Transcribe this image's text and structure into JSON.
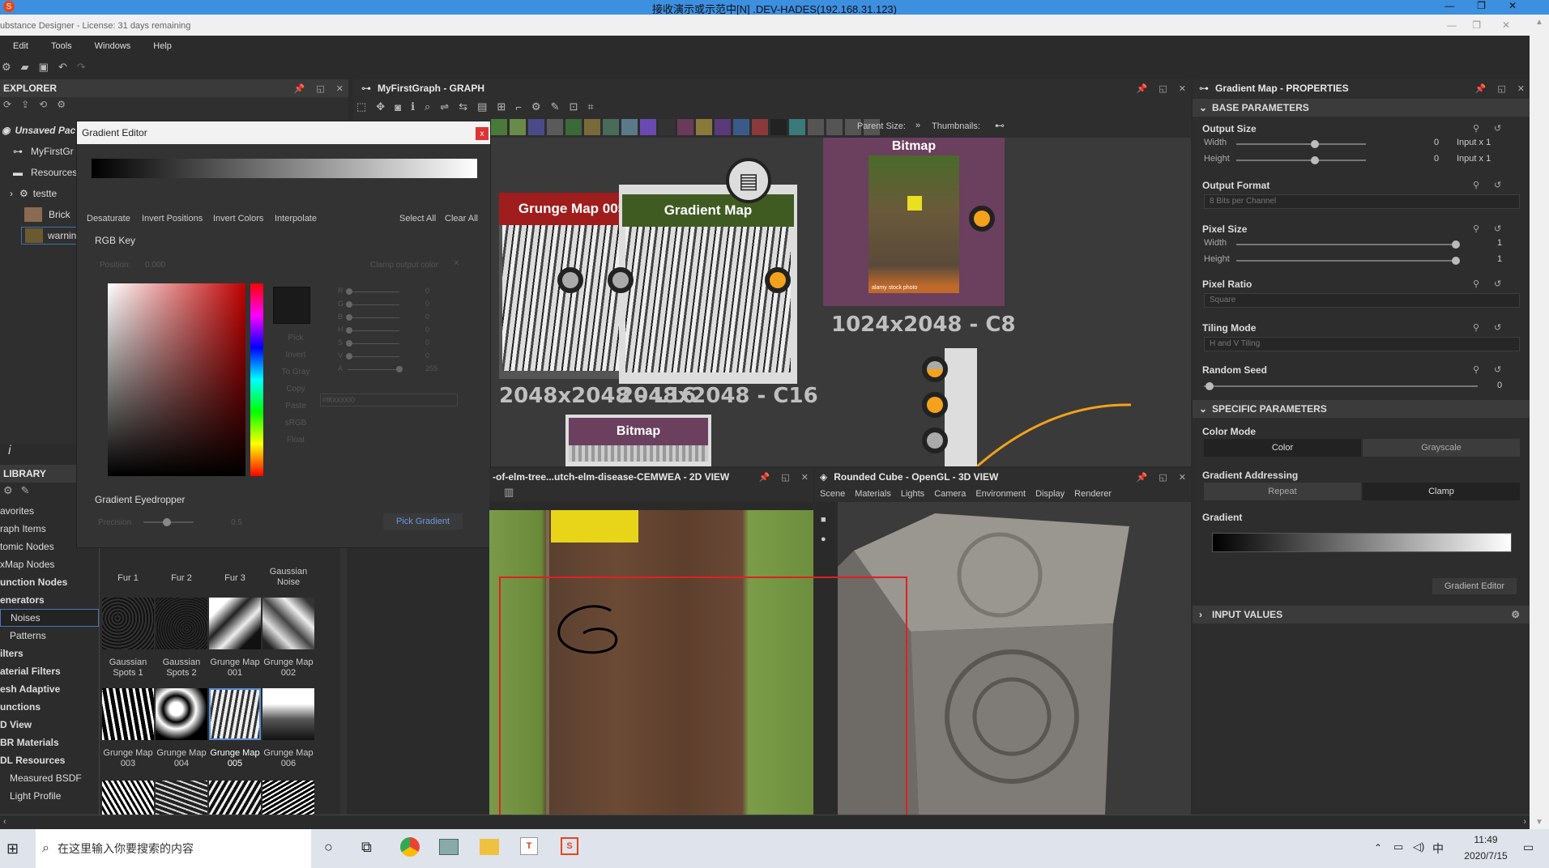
{
  "rdp": {
    "title": "接收演示或示范中[N] .DEV-HADES(192.168.31.123)"
  },
  "app": {
    "title": "ubstance Designer - License: 31 days remaining"
  },
  "menu": [
    "Edit",
    "Tools",
    "Windows",
    "Help"
  ],
  "explorer": {
    "title": "EXPLORER",
    "items": [
      "Unsaved Pac",
      "MyFirstGr",
      "Resources",
      "testte",
      "Brick",
      "warnin"
    ]
  },
  "gradient_editor": {
    "title": "Gradient Editor",
    "actions": [
      "Desaturate",
      "Invert Positions",
      "Invert Colors",
      "Interpolate"
    ],
    "select_all": "Select All",
    "clear_all": "Clear All",
    "rgb_key": "RGB Key",
    "position_label": "Position:",
    "position_value": "0.000",
    "clamp_label": "Clamp output color",
    "channels": [
      {
        "name": "R",
        "value": "0"
      },
      {
        "name": "G",
        "value": "0"
      },
      {
        "name": "B",
        "value": "0"
      },
      {
        "name": "H",
        "value": "0"
      },
      {
        "name": "S",
        "value": "0"
      },
      {
        "name": "V",
        "value": "0"
      },
      {
        "name": "A",
        "value": "255"
      }
    ],
    "side_buttons": [
      "Pick",
      "Invert",
      "To Gray",
      "Copy",
      "Paste",
      "sRGB",
      "Float"
    ],
    "hex": "#ff000000",
    "eyedropper_title": "Gradient Eyedropper",
    "precision_label": "Precision",
    "precision_value": "0.5",
    "pick_gradient": "Pick Gradient"
  },
  "graph": {
    "title": "MyFirstGraph - GRAPH",
    "parent_size_label": "Parent Size:",
    "thumbnails_label": "Thumbnails:",
    "nodes": [
      {
        "title": "Grunge Map 005",
        "res": "2048x2048 - L16"
      },
      {
        "title": "Gradient Map",
        "res": "2048x2048 - C16"
      },
      {
        "title": "Bitmap",
        "res": "1024x2048 - C8"
      },
      {
        "title": "Bitmap",
        "res": ""
      }
    ],
    "bitmap_watermark": "alamy stock photo"
  },
  "library": {
    "title": "LIBRARY",
    "categories": [
      {
        "label": "avorites",
        "bold": false
      },
      {
        "label": "raph Items",
        "bold": false
      },
      {
        "label": "tomic Nodes",
        "bold": false
      },
      {
        "label": "xMap Nodes",
        "bold": false
      },
      {
        "label": "unction Nodes",
        "bold": true
      },
      {
        "label": "enerators",
        "bold": true
      },
      {
        "label": "Noises",
        "bold": false
      },
      {
        "label": "Patterns",
        "bold": false
      },
      {
        "label": "ilters",
        "bold": true
      },
      {
        "label": "aterial Filters",
        "bold": true
      },
      {
        "label": "esh Adaptive",
        "bold": true
      },
      {
        "label": "unctions",
        "bold": true
      },
      {
        "label": "D View",
        "bold": true
      },
      {
        "label": "BR Materials",
        "bold": true
      },
      {
        "label": "DL Resources",
        "bold": true
      },
      {
        "label": "Measured BSDF",
        "bold": false
      },
      {
        "label": "Light Profile",
        "bold": false
      }
    ],
    "thumbs": [
      [
        "Fur 1",
        "Fur 2",
        "Fur 3",
        "Gaussian Noise"
      ],
      [
        "Gaussian Spots 1",
        "Gaussian Spots 2",
        "Grunge Map 001",
        "Grunge Map 002"
      ],
      [
        "Grunge Map 003",
        "Grunge Map 004",
        "Grunge Map 005",
        "Grunge Map 006"
      ]
    ]
  },
  "view2d": {
    "title": "-of-elm-tree...utch-elm-disease-CEMWEA - 2D VIEW"
  },
  "view3d": {
    "title": "Rounded Cube - OpenGL - 3D VIEW",
    "menu": [
      "Scene",
      "Materials",
      "Lights",
      "Camera",
      "Environment",
      "Display",
      "Renderer"
    ]
  },
  "properties": {
    "title": "Gradient Map - PROPERTIES",
    "base_parameters": "BASE PARAMETERS",
    "output_size": "Output Size",
    "width": "Width",
    "height": "Height",
    "output_width_value": "0",
    "output_width_mode": "Input x 1",
    "output_height_value": "0",
    "output_height_mode": "Input x 1",
    "output_format": "Output Format",
    "output_format_value": "8 Bits per Channel",
    "pixel_size": "Pixel Size",
    "pixel_width_value": "1",
    "pixel_height_value": "1",
    "pixel_ratio": "Pixel Ratio",
    "pixel_ratio_value": "Square",
    "tiling_mode": "Tiling Mode",
    "tiling_mode_value": "H and V Tiling",
    "random_seed": "Random Seed",
    "random_seed_value": "0",
    "specific_parameters": "SPECIFIC PARAMETERS",
    "color_mode": "Color Mode",
    "color_mode_options": [
      "Color",
      "Grayscale"
    ],
    "gradient_addressing": "Gradient Addressing",
    "addressing_options": [
      "Repeat",
      "Clamp"
    ],
    "gradient": "Gradient",
    "gradient_editor_button": "Gradient Editor",
    "input_values": "INPUT VALUES"
  },
  "taskbar": {
    "search_placeholder": "在这里输入你要搜索的内容",
    "time": "11:49",
    "date": "2020/7/15",
    "ime": "中"
  },
  "colors": {
    "grunge_header": "#a01d1d",
    "gradient_header": "#3f5b22",
    "bitmap_header": "#6b3f5e",
    "port_orange": "#f4a11b",
    "annotation_red": "#e02020"
  }
}
